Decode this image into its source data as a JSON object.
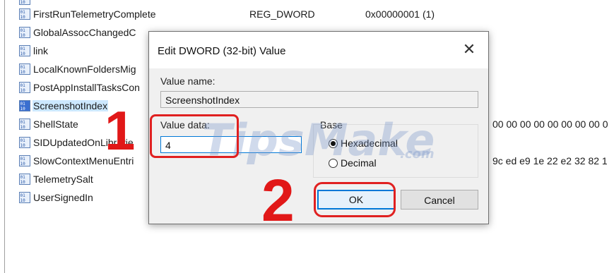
{
  "registry": {
    "rows": [
      {
        "name": "FirstRunTelemetryComplete",
        "type": "REG_DWORD",
        "data": "0x00000001 (1)",
        "icon": "binary-value-icon"
      },
      {
        "name": "GlobalAssocChangedC",
        "type": "",
        "data": "",
        "icon": "binary-value-icon"
      },
      {
        "name": "link",
        "type": "",
        "data": "",
        "icon": "binary-value-icon"
      },
      {
        "name": "LocalKnownFoldersMig",
        "type": "",
        "data": "",
        "icon": "binary-value-icon"
      },
      {
        "name": "PostAppInstallTasksCon",
        "type": "",
        "data": "",
        "icon": "binary-value-icon"
      },
      {
        "name": "ScreenshotIndex",
        "type": "",
        "data": "",
        "icon": "binary-value-icon",
        "selected": true
      },
      {
        "name": "ShellState",
        "type": "",
        "data": "00 00 00 00 00 00 00 00 0",
        "icon": "binary-value-icon"
      },
      {
        "name": "SIDUpdatedOnLibrarie",
        "type": "",
        "data": "",
        "icon": "binary-value-icon"
      },
      {
        "name": "SlowContextMenuEntri",
        "type": "",
        "data": "9c ed e9 1e 22 e2 32 82 1",
        "icon": "binary-value-icon"
      },
      {
        "name": "TelemetrySalt",
        "type": "",
        "data": "",
        "icon": "binary-value-icon"
      },
      {
        "name": "UserSignedIn",
        "type": "",
        "data": "",
        "icon": "binary-value-icon"
      }
    ]
  },
  "dialog": {
    "title": "Edit DWORD (32-bit) Value",
    "close_glyph": "✕",
    "value_name_label": "Value name:",
    "value_name": "ScreenshotIndex",
    "value_data_label": "Value data:",
    "value_data": "4",
    "base_label": "Base",
    "base_options": [
      {
        "label": "Hexadecimal",
        "selected": true
      },
      {
        "label": "Decimal",
        "selected": false
      }
    ],
    "ok_label": "OK",
    "cancel_label": "Cancel"
  },
  "annotations": {
    "step1": "1",
    "step2": "2",
    "accent_color": "#e02020"
  },
  "watermark": {
    "text": "TipsMake",
    "suffix": ".com"
  }
}
